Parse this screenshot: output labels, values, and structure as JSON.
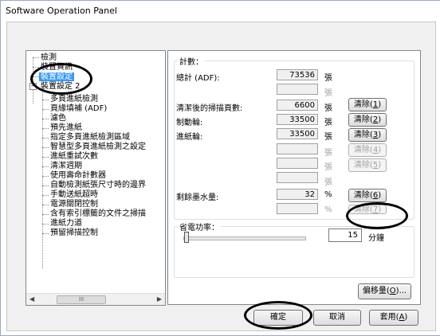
{
  "window": {
    "title": "Software Operation Panel"
  },
  "tree": {
    "items": [
      {
        "label": "檢測"
      },
      {
        "label": "裝置資訊"
      },
      {
        "label": "裝置設定"
      },
      {
        "label": "裝置設定 2"
      },
      {
        "label": "多頁進紙檢測"
      },
      {
        "label": "頁緣填補 (ADF)"
      },
      {
        "label": "濾色"
      },
      {
        "label": "預先進紙"
      },
      {
        "label": "指定多頁進紙檢測區域"
      },
      {
        "label": "智慧型多頁進紙檢測之設定"
      },
      {
        "label": "進紙重試次數"
      },
      {
        "label": "清潔週期"
      },
      {
        "label": "使用壽命計數器"
      },
      {
        "label": "自動檢測紙張尺寸時的邊界"
      },
      {
        "label": "手動送紙超時"
      },
      {
        "label": "電源關閉控制"
      },
      {
        "label": "含有索引標籤的文件之掃描"
      },
      {
        "label": "進紙力道"
      },
      {
        "label": "預留掃描控制"
      }
    ],
    "scroll_thumb": "III"
  },
  "counter": {
    "legend": "計數：",
    "total_label": "總計 (ADF):",
    "total_value": "73536",
    "total_unit": "張",
    "blank_unit_1": "張",
    "after_clean_label": "清潔後的掃描頁數:",
    "after_clean_value": "6600",
    "after_clean_unit": "張",
    "brake_label": "制動輪:",
    "brake_value": "33500",
    "brake_unit": "張",
    "pick_label": "進紙輪:",
    "pick_value": "33500",
    "pick_unit": "張",
    "blank_unit_2": "張",
    "blank_unit_3": "張",
    "blank_unit_4": "張",
    "ink_label": "剩餘墨水量:",
    "ink_value": "32",
    "ink_unit": "%",
    "blank_unit_5": "%",
    "clear1": "清除(",
    "clear1_key": "1",
    "clear2": "清除(",
    "clear2_key": "2",
    "clear3": "清除(",
    "clear3_key": "3",
    "clear4": "清除(",
    "clear4_key": "4",
    "clear5": "清除(",
    "clear5_key": "5",
    "clear6": "清除(",
    "clear6_key": "6",
    "clear7": "清除(",
    "clear7_key": "7",
    "close_paren": ")"
  },
  "power": {
    "legend": "省電功率：",
    "value": "15",
    "unit": "分鐘",
    "slider_level": 0
  },
  "offset_button": {
    "label": "偏移量(",
    "key": "O",
    "suffix": ")..."
  },
  "footer": {
    "ok": "確定",
    "cancel": "取消",
    "apply_prefix": "套用(",
    "apply_key": "A",
    "apply_suffix": ")"
  }
}
